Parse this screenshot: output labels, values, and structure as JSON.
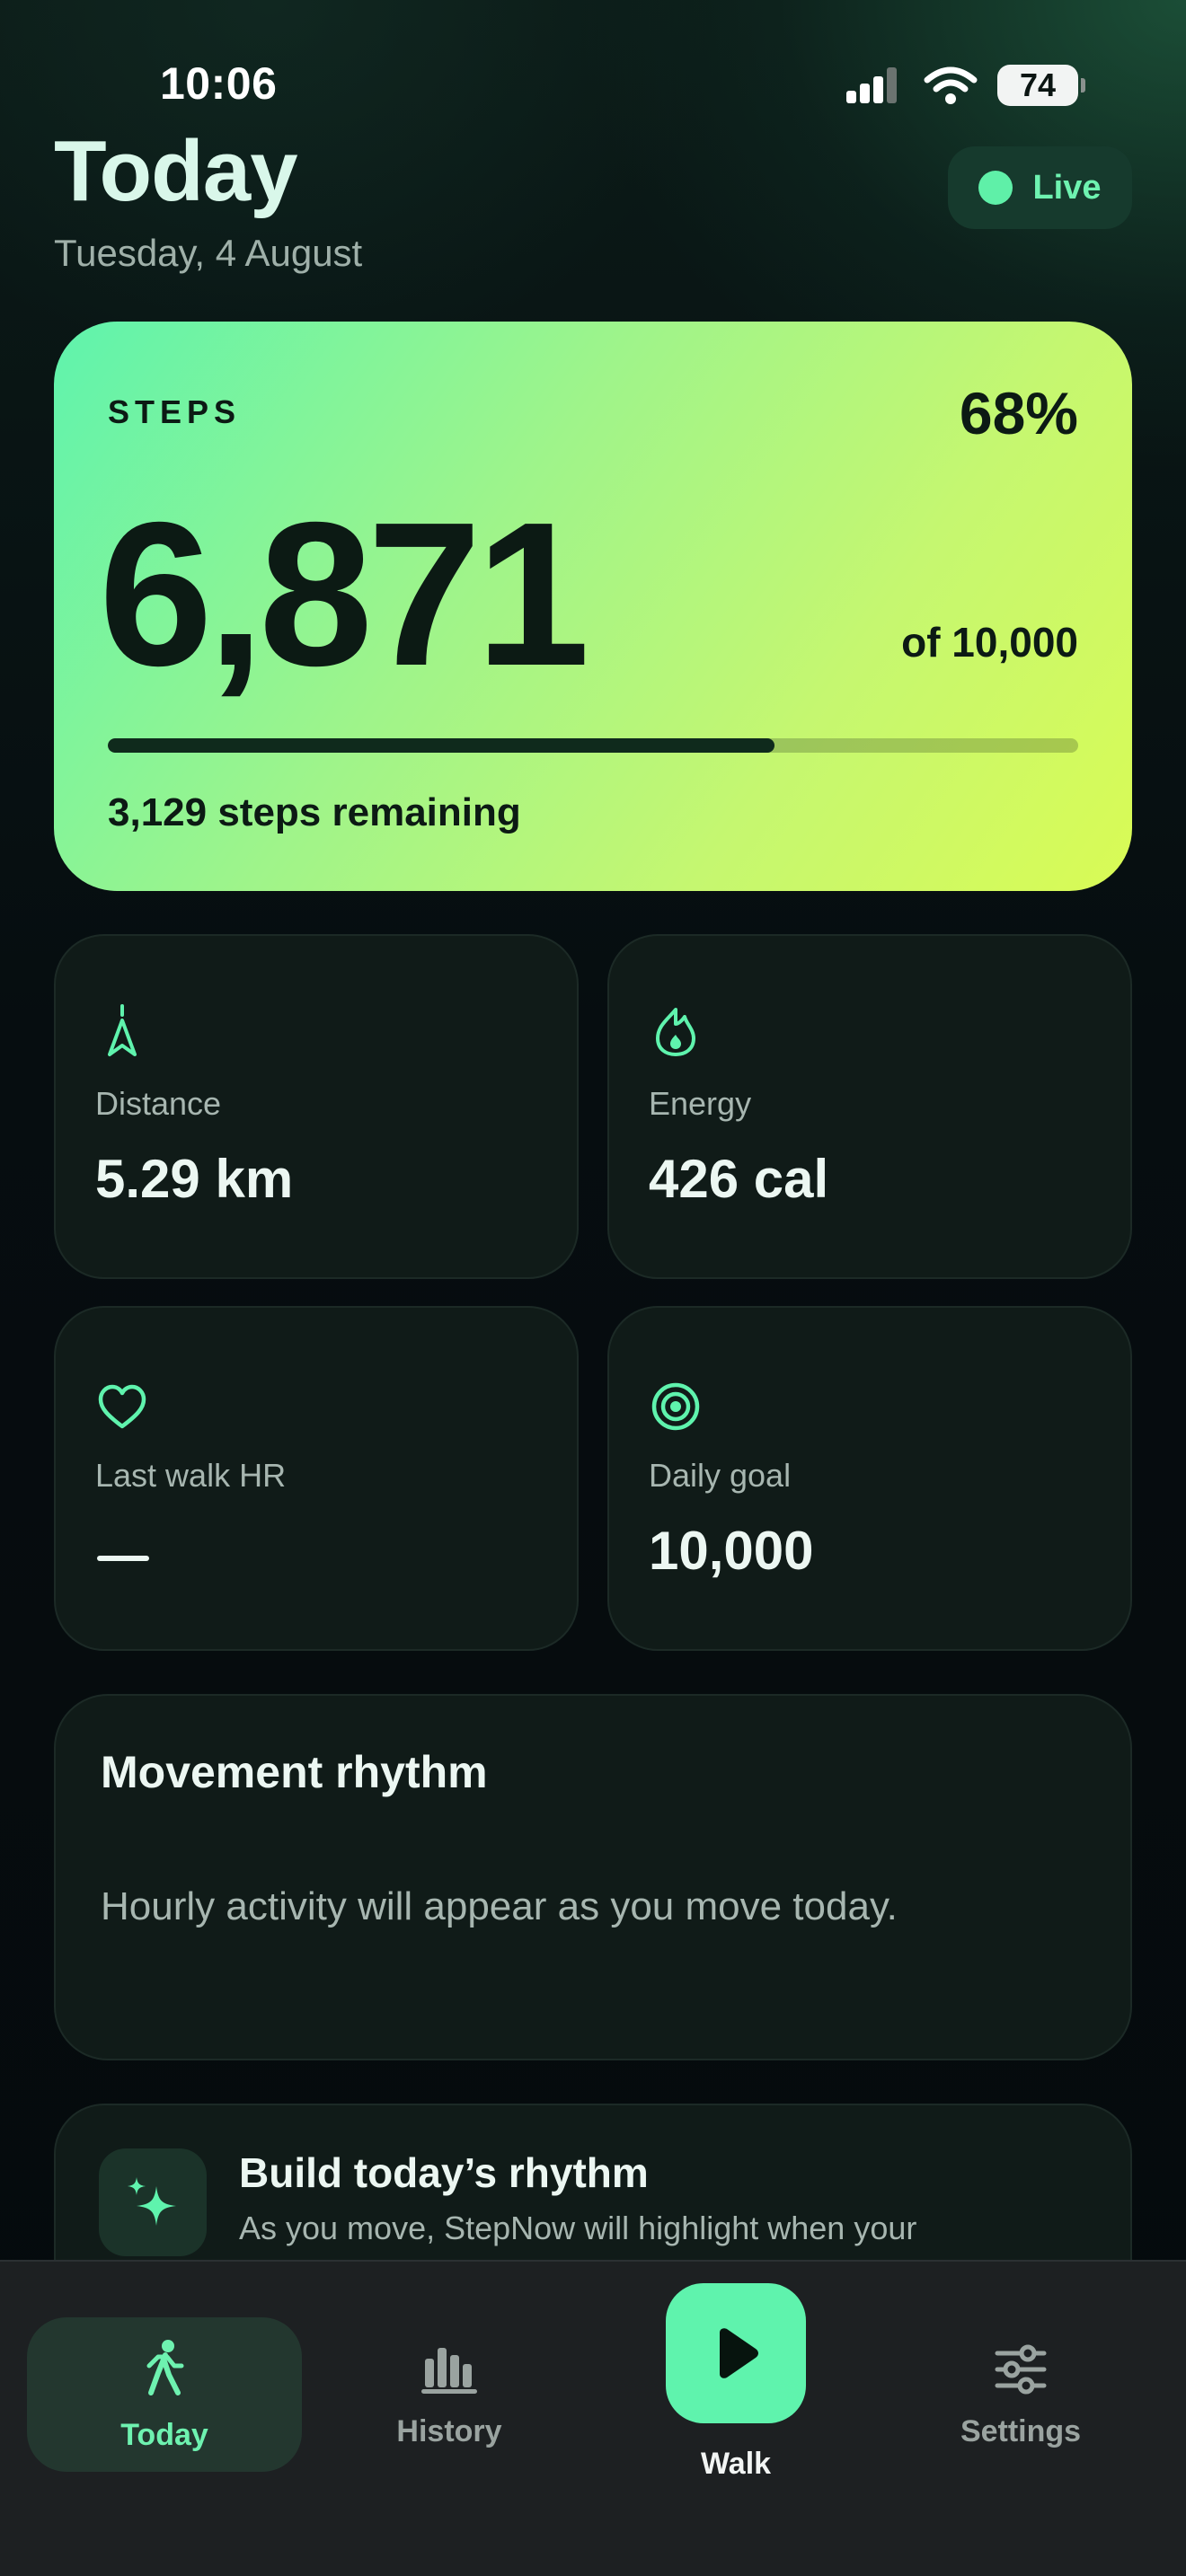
{
  "status_bar": {
    "time": "10:06",
    "battery": "74"
  },
  "header": {
    "title": "Today",
    "date": "Tuesday, 4 August",
    "live_label": "Live"
  },
  "steps": {
    "label": "STEPS",
    "percent_text": "68%",
    "value": "6,871",
    "goal_text": "of 10,000",
    "progress": 0.687,
    "remaining_text": "3,129 steps remaining"
  },
  "stats": {
    "distance": {
      "label": "Distance",
      "value": "5.29 km",
      "icon": "navigation-arrow-icon"
    },
    "energy": {
      "label": "Energy",
      "value": "426 cal",
      "icon": "flame-icon"
    },
    "heart_rate": {
      "label": "Last walk HR",
      "value": "—",
      "icon": "heart-icon"
    },
    "daily_goal": {
      "label": "Daily goal",
      "value": "10,000",
      "icon": "target-icon"
    }
  },
  "rhythm": {
    "title": "Movement rhythm",
    "subtitle": "Hourly activity will appear as you move today."
  },
  "build": {
    "title": "Build today’s rhythm",
    "subtitle": "As you move, StepNow will highlight when your",
    "icon": "sparkles-icon"
  },
  "tabs": [
    {
      "label": "Today",
      "icon": "walking-icon",
      "active": true
    },
    {
      "label": "History",
      "icon": "bar-chart-icon",
      "active": false
    },
    {
      "label": "Walk",
      "icon": "play-icon",
      "active": false
    },
    {
      "label": "Settings",
      "icon": "sliders-icon",
      "active": false
    }
  ],
  "colors": {
    "accent": "#5ff3ad",
    "background": "#050b0d",
    "card": "#101b18"
  }
}
